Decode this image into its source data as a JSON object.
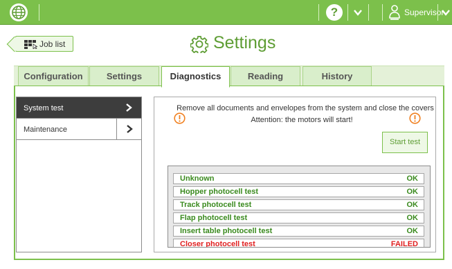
{
  "topbar": {
    "help_icon": "question-circle-icon",
    "user_label": "Supervisor",
    "colors": {
      "bar": "#7cc04b",
      "bar_dark": "#5e9d34"
    }
  },
  "header": {
    "back_label": "Job list",
    "title": "Settings",
    "title_icon": "gear-icon"
  },
  "tabs": [
    {
      "label": "Configuration",
      "active": false
    },
    {
      "label": "Settings",
      "active": false
    },
    {
      "label": "Diagnostics",
      "active": true
    },
    {
      "label": "Reading",
      "active": false
    },
    {
      "label": "History",
      "active": false
    }
  ],
  "sidenav": [
    {
      "label": "System test",
      "selected": true
    },
    {
      "label": "Maintenance",
      "selected": false
    }
  ],
  "diagnostics": {
    "instruction": "Remove all documents and envelopes from the system and close the covers",
    "attention": "Attention: the motors will start!",
    "start_button": "Start test",
    "results": [
      {
        "name": "Unknown",
        "status": "OK"
      },
      {
        "name": "Hopper photocell test",
        "status": "OK"
      },
      {
        "name": "Track photocell test",
        "status": "OK"
      },
      {
        "name": "Flap photocell test",
        "status": "OK"
      },
      {
        "name": "Insert table photocell test",
        "status": "OK"
      },
      {
        "name": "Closer photocell test",
        "status": "FAILED"
      }
    ],
    "colors": {
      "ok": "#3a8a1e",
      "failed": "#e02020",
      "warning": "#f08020"
    }
  }
}
